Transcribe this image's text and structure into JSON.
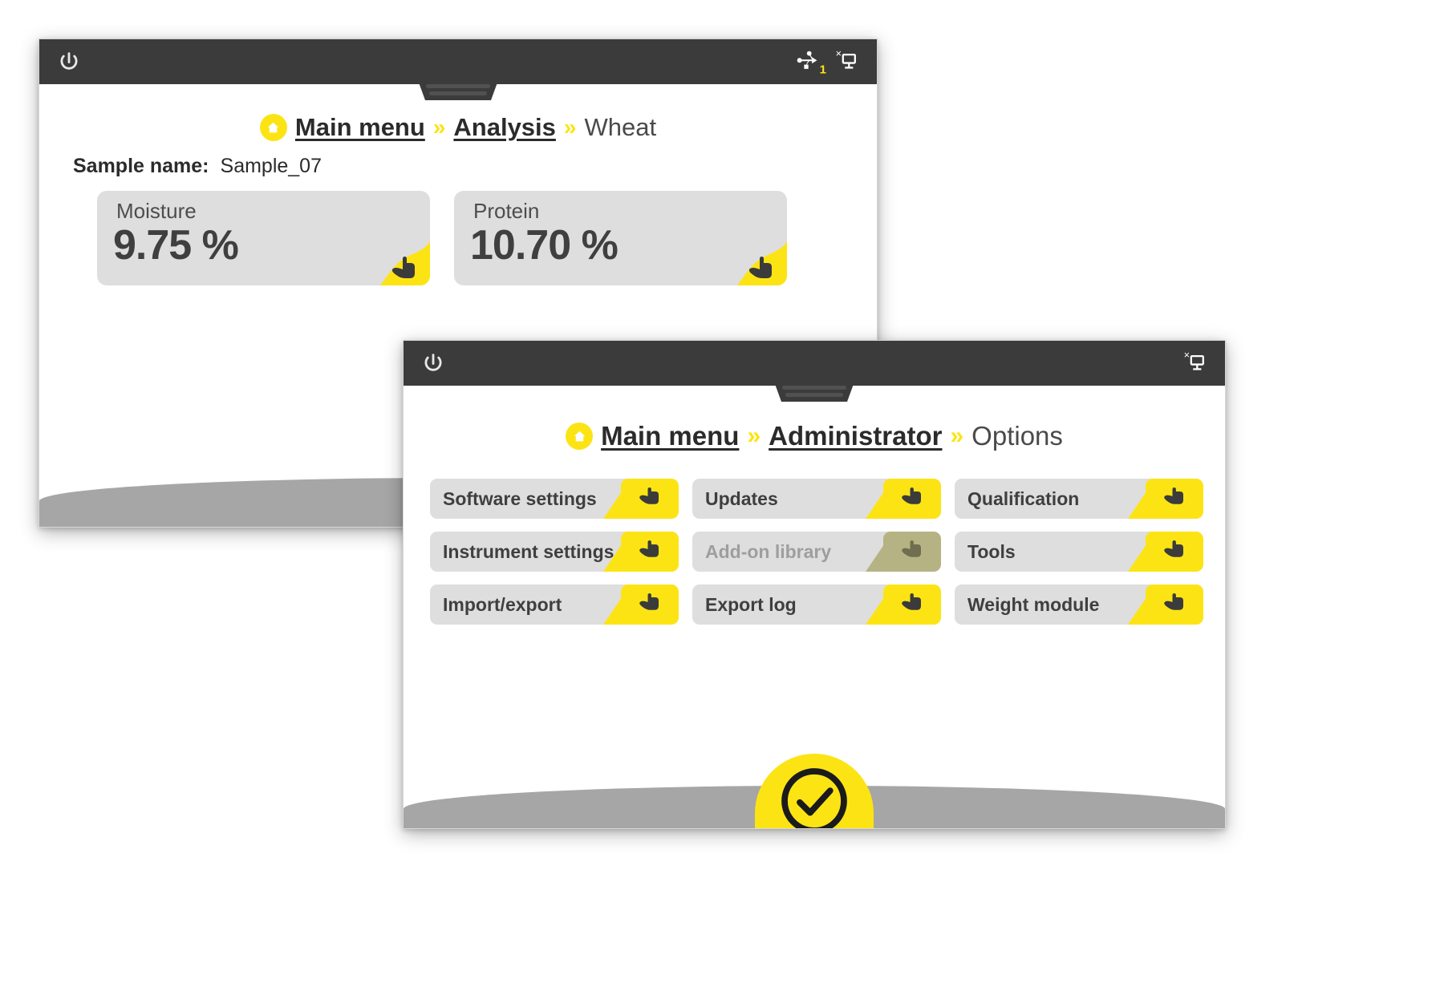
{
  "windows": [
    {
      "id": "analysis-window",
      "titlebar": {
        "power_icon": "power-icon",
        "tray": [
          {
            "icon": "usb-icon",
            "badge": "1"
          },
          {
            "icon": "network-disconnected-icon",
            "badge": "×"
          }
        ]
      },
      "breadcrumb": {
        "home_icon": "home-icon",
        "items": [
          {
            "label": "Main menu",
            "type": "link"
          },
          {
            "label": "»",
            "type": "separator"
          },
          {
            "label": "Analysis",
            "type": "link"
          },
          {
            "label": "»",
            "type": "separator"
          },
          {
            "label": "Wheat",
            "type": "current"
          }
        ]
      },
      "sample": {
        "label": "Sample name:",
        "value": "Sample_07"
      },
      "results": [
        {
          "name": "Moisture",
          "value": "9.75 %",
          "tap_icon": "hand-pointer-icon"
        },
        {
          "name": "Protein",
          "value": "10.70 %",
          "tap_icon": "hand-pointer-icon"
        }
      ]
    },
    {
      "id": "administrator-options-window",
      "titlebar": {
        "power_icon": "power-icon",
        "tray": [
          {
            "icon": "network-disconnected-icon",
            "badge": "×"
          }
        ]
      },
      "breadcrumb": {
        "home_icon": "home-icon",
        "items": [
          {
            "label": "Main menu",
            "type": "link"
          },
          {
            "label": "»",
            "type": "separator"
          },
          {
            "label": "Administrator",
            "type": "link"
          },
          {
            "label": "»",
            "type": "separator"
          },
          {
            "label": "Options",
            "type": "current"
          }
        ]
      },
      "options": [
        {
          "label": "Software settings",
          "disabled": false,
          "icon": "hand-pointer-icon"
        },
        {
          "label": "Updates",
          "disabled": false,
          "icon": "hand-pointer-icon"
        },
        {
          "label": "Qualification",
          "disabled": false,
          "icon": "hand-pointer-icon"
        },
        {
          "label": "Instrument settings",
          "disabled": false,
          "icon": "hand-pointer-icon"
        },
        {
          "label": "Add-on library",
          "disabled": true,
          "icon": "hand-pointer-icon"
        },
        {
          "label": "Tools",
          "disabled": false,
          "icon": "hand-pointer-icon"
        },
        {
          "label": "Import/export",
          "disabled": false,
          "icon": "hand-pointer-icon"
        },
        {
          "label": "Export log",
          "disabled": false,
          "icon": "hand-pointer-icon"
        },
        {
          "label": "Weight module",
          "disabled": false,
          "icon": "hand-pointer-icon"
        }
      ],
      "confirm": {
        "icon": "checkmark-circle-icon",
        "label": ""
      }
    }
  ],
  "colors": {
    "accent_yellow": "#FCE414",
    "titlebar_dark": "#3b3b3b",
    "button_gray": "#dedede",
    "text_dark": "#3f3f3f",
    "disabled_text": "#9e9e9e",
    "disabled_yellow": "#b5b383",
    "base_gray": "#a6a6a6"
  }
}
